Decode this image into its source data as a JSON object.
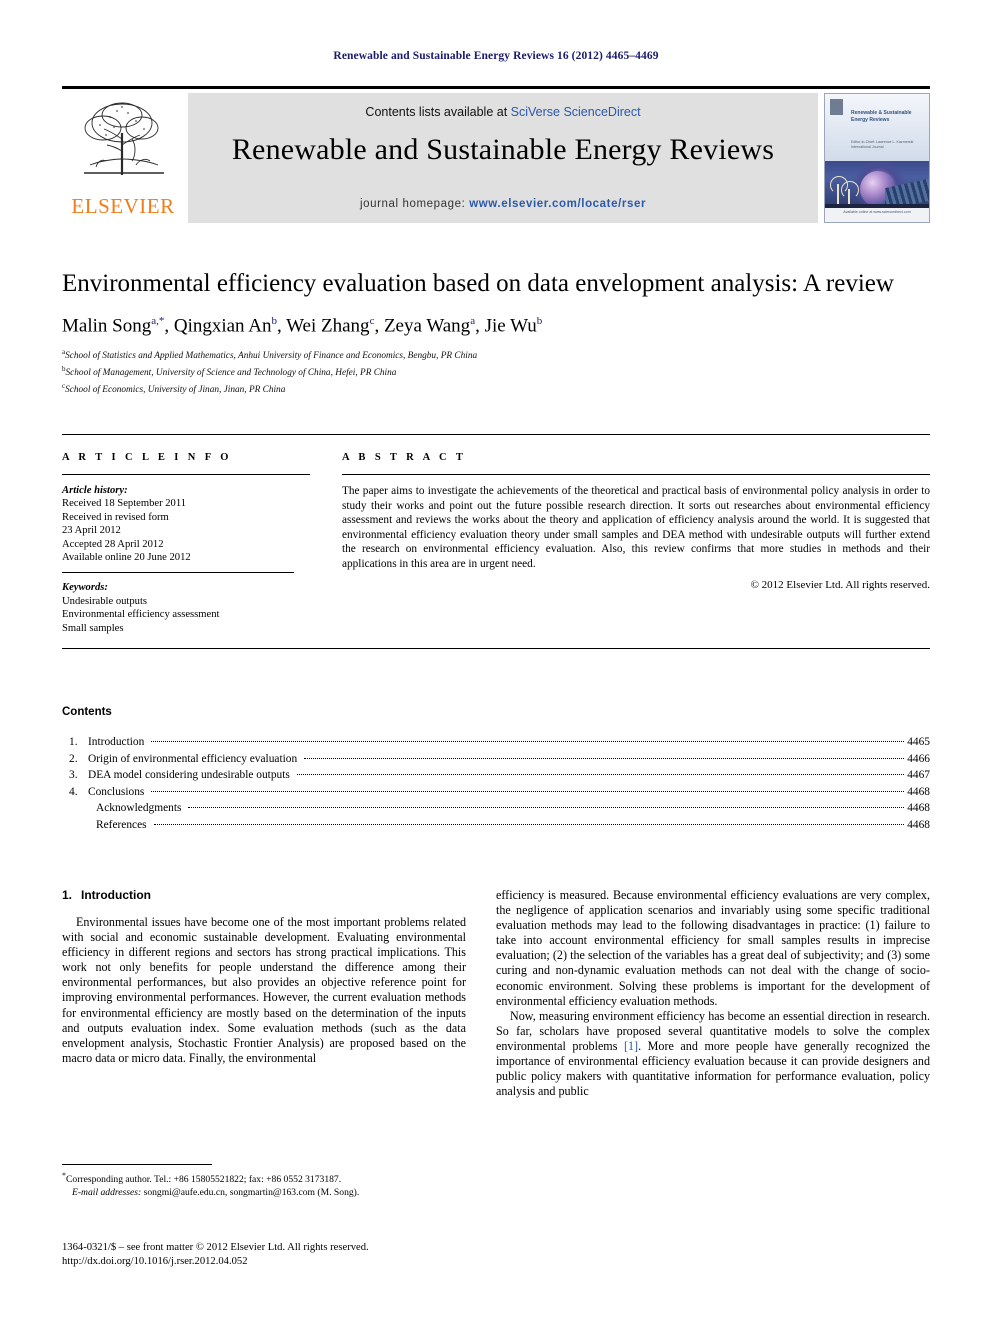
{
  "running_head": "Renewable and Sustainable Energy Reviews 16 (2012) 4465–4469",
  "masthead": {
    "contents_prefix": "Contents lists available at ",
    "sciencedirect": "SciVerse ScienceDirect",
    "journal_title": "Renewable and Sustainable Energy Reviews",
    "homepage_prefix": "journal homepage: ",
    "homepage_url": "www.elsevier.com/locate/rser",
    "publisher_wordmark": "ELSEVIER",
    "cover": {
      "title": "Renewable & Sustainable Energy Reviews",
      "subtitle": "Editor-in-Chief: Lawrence L. Kazmerski  International Journal",
      "footer": "Available online at www.sciencedirect.com"
    }
  },
  "article": {
    "title": "Environmental efficiency evaluation based on data envelopment analysis: A review",
    "authors_html": "Malin Song<sup>a,</sup><sup>*</sup>, Qingxian An<sup>b</sup>, Wei Zhang<sup>c</sup>, Zeya Wang<sup>a</sup>, Jie Wu<sup>b</sup>",
    "affiliations": [
      {
        "marker": "a",
        "text": "School of Statistics and Applied Mathematics, Anhui University of Finance and Economics, Bengbu, PR China"
      },
      {
        "marker": "b",
        "text": "School of Management, University of Science and Technology of China, Hefei, PR China"
      },
      {
        "marker": "c",
        "text": "School of Economics, University of Jinan, Jinan, PR China"
      }
    ]
  },
  "info": {
    "heading": "A R T I C L E  I N F O",
    "history_label": "Article history:",
    "history": [
      "Received 18 September 2011",
      "Received in revised form",
      "23 April 2012",
      "Accepted 28 April 2012",
      "Available online 20 June 2012"
    ],
    "keywords_label": "Keywords:",
    "keywords": [
      "Undesirable outputs",
      "Environmental efficiency assessment",
      "Small samples"
    ]
  },
  "abstract": {
    "heading": "A B S T R A C T",
    "text": "The paper aims to investigate the achievements of the theoretical and practical basis of environmental policy analysis in order to study their works and point out the future possible research direction. It sorts out researches about environmental efficiency assessment and reviews the works about the theory and application of efficiency analysis around the world. It is suggested that environmental efficiency evaluation theory under small samples and DEA method with undesirable outputs will further extend the research on environmental efficiency evaluation. Also, this review confirms that more studies in methods and their applications in this area are in urgent need.",
    "copyright": "© 2012 Elsevier Ltd. All rights reserved."
  },
  "contents": {
    "heading": "Contents",
    "items": [
      {
        "num": "1.",
        "label": "Introduction",
        "page": "4465",
        "sub": false
      },
      {
        "num": "2.",
        "label": "Origin of environmental efficiency evaluation",
        "page": "4466",
        "sub": false
      },
      {
        "num": "3.",
        "label": "DEA model considering undesirable outputs",
        "page": "4467",
        "sub": false
      },
      {
        "num": "4.",
        "label": "Conclusions",
        "page": "4468",
        "sub": false
      },
      {
        "num": "",
        "label": "Acknowledgments",
        "page": "4468",
        "sub": true
      },
      {
        "num": "",
        "label": "References",
        "page": "4468",
        "sub": true
      }
    ]
  },
  "body": {
    "section_num": "1.",
    "section_title": "Introduction",
    "left_paragraph": "Environmental issues have become one of the most important problems related with social and economic sustainable development. Evaluating environmental efficiency in different regions and sectors has strong practical implications. This work not only benefits for people understand the difference among their environmental performances, but also provides an objective reference point for improving environmental performances. However, the current evaluation methods for environmental efficiency are mostly based on the determination of the inputs and outputs evaluation index. Some evaluation methods (such as the data envelopment analysis, Stochastic Frontier Analysis) are proposed based on the macro data or micro data. Finally, the environmental",
    "right_paragraph_1": "efficiency is measured. Because environmental efficiency evaluations are very complex, the negligence of application scenarios and invariably using some specific traditional evaluation methods may lead to the following disadvantages in practice: (1) failure to take into account environmental efficiency for small samples results in imprecise evaluation; (2) the selection of the variables has a great deal of subjectivity; and (3) some curing and non-dynamic evaluation methods can not deal with the change of socio-economic environment. Solving these problems is important for the development of environmental efficiency evaluation methods.",
    "right_paragraph_2_a": "Now, measuring environment efficiency has become an essential direction in research. So far, scholars have proposed several quantitative models to solve the complex environmental problems ",
    "right_citation": "[1]",
    "right_paragraph_2_b": ". More and more people have generally recognized the importance of environmental efficiency evaluation because it can provide designers and public policy makers with quantitative information for performance evaluation, policy analysis and public"
  },
  "footnote": {
    "corresponding": "Corresponding author. Tel.: +86 15805521822; fax: +86 0552 3173187.",
    "email_label": "E-mail addresses:",
    "emails": "songmi@aufe.edu.cn, songmartin@163.com (M. Song)."
  },
  "footer": {
    "issn_line": "1364-0321/$ – see front matter © 2012 Elsevier Ltd. All rights reserved.",
    "doi_line": "http://dx.doi.org/10.1016/j.rser.2012.04.052"
  }
}
